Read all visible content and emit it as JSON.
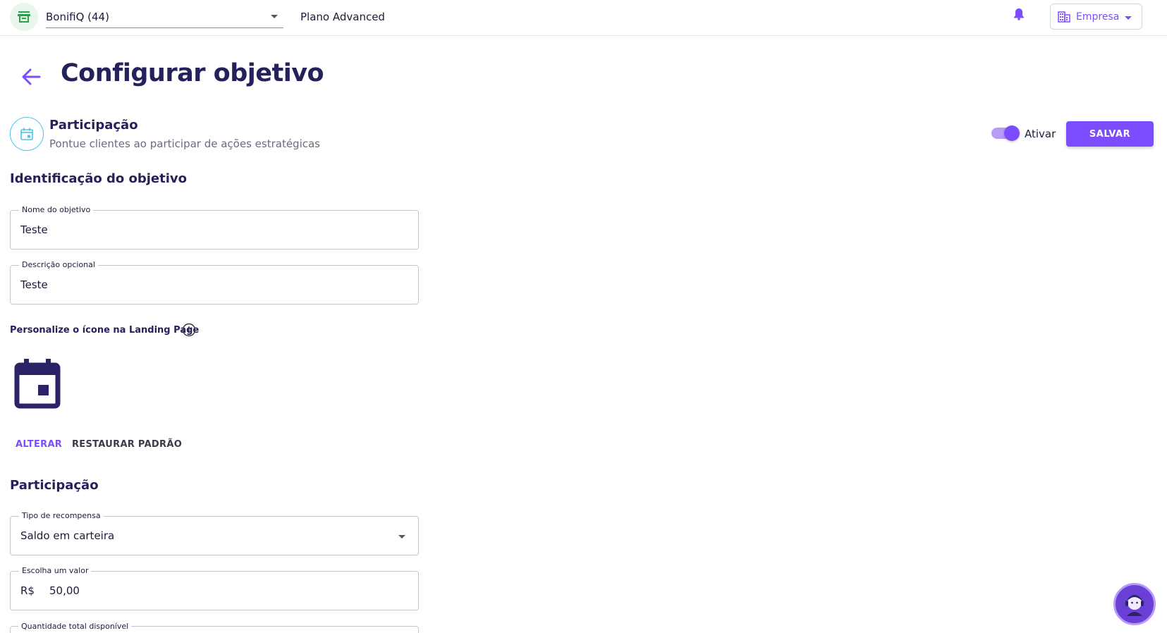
{
  "header": {
    "store_icon": "store-icon",
    "store_name": "BonifiQ (44)",
    "plan": "Plano Advanced",
    "bell_icon": "bell-icon",
    "company_label": "Empresa",
    "company_icon": "building-icon"
  },
  "page": {
    "title": "Configurar objetivo",
    "back_icon": "arrow-left-icon"
  },
  "objective": {
    "icon": "calendar-icon",
    "title": "Participação",
    "subtitle": "Pontue clientes ao participar de ações estratégicas",
    "toggle_label": "Ativar",
    "toggle_on": true,
    "save_label": "SALVAR"
  },
  "identification": {
    "section_title": "Identificação do objetivo",
    "name_label": "Nome do objetivo",
    "name_value": "Teste",
    "description_label": "Descrição opcional",
    "description_value": "Teste",
    "icon_label": "Personalize o ícone na Landing Page",
    "info_icon": "info-icon",
    "landing_icon": "calendar-icon",
    "change_label": "ALTERAR",
    "restore_label": "RESTAURAR PADRÃO"
  },
  "participation": {
    "section_title": "Participação",
    "reward_type_label": "Tipo de recompensa",
    "reward_type_value": "Saldo em carteira",
    "value_label": "Escolha um valor",
    "value_prefix": "R$",
    "value_amount": "50,00",
    "quantity_label": "Quantidade total disponível"
  },
  "support": {
    "icon": "support-agent-icon"
  },
  "colors": {
    "accent": "#7c4dff",
    "title": "#25215a",
    "store_green": "#2e9e4f",
    "info_blue": "#48c6e8"
  }
}
